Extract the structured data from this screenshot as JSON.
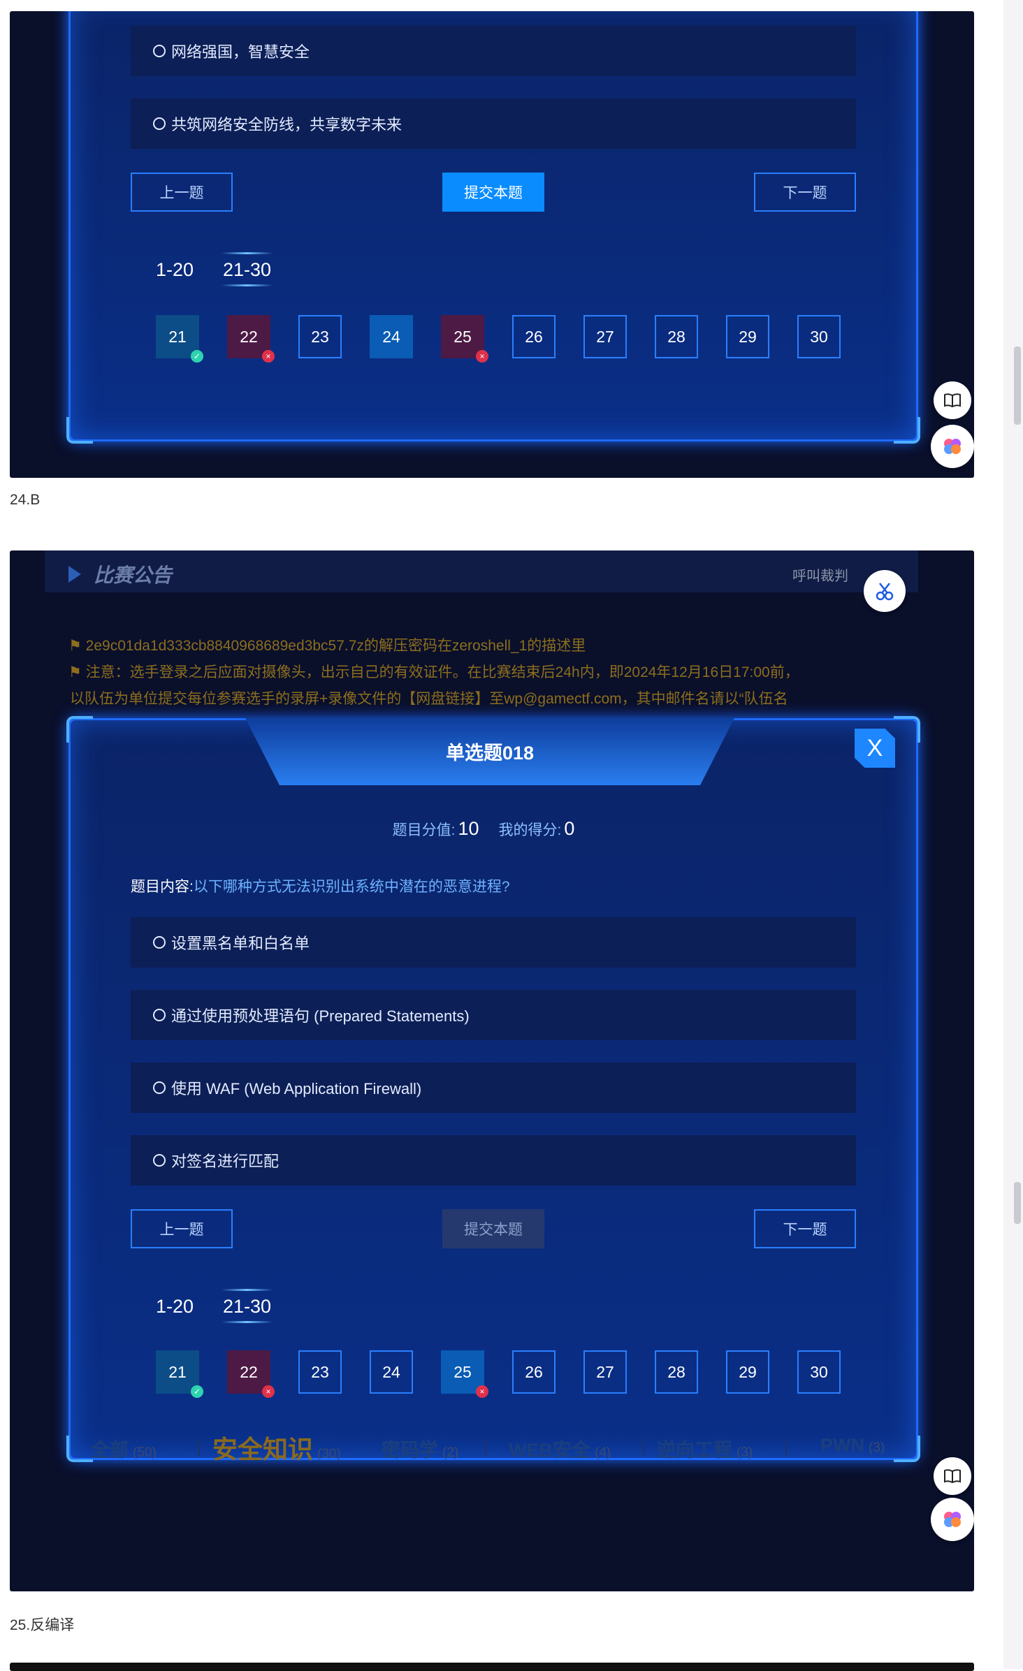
{
  "screenshot1": {
    "options": [
      "网络强国，智慧安全",
      "共筑网络安全防线，共享数字未来"
    ],
    "buttons": {
      "prev": "上一题",
      "submit": "提交本题",
      "next": "下一题"
    },
    "ranges": [
      "1-20",
      "21-30"
    ],
    "questions": [
      {
        "num": "21",
        "state": "correct"
      },
      {
        "num": "22",
        "state": "wrong"
      },
      {
        "num": "23",
        "state": "none"
      },
      {
        "num": "24",
        "state": "current"
      },
      {
        "num": "25",
        "state": "wrong"
      },
      {
        "num": "26",
        "state": "none"
      },
      {
        "num": "27",
        "state": "none"
      },
      {
        "num": "28",
        "state": "none"
      },
      {
        "num": "29",
        "state": "none"
      },
      {
        "num": "30",
        "state": "none"
      }
    ]
  },
  "caption1": "24.B",
  "screenshot2": {
    "announcement_title": "比赛公告",
    "referee": "呼叫裁判",
    "notices": [
      "2e9c01da1d333cb8840968689ed3bc57.7z的解压密码在zeroshell_1的描述里",
      "注意：选手登录之后应面对摄像头，出示自己的有效证件。在比赛结束后24h内，即2024年12月16日17:00前，",
      "以队伍为单位提交每位参赛选手的录屏+录像文件的【网盘链接】至wp@gamectf.com，其中邮件名请以“队伍名"
    ],
    "modal_title": "单选题018",
    "close": "X",
    "score_label": "题目分值:",
    "score_value": "10",
    "my_score_label": "我的得分:",
    "my_score_value": "0",
    "question_label": "题目内容:",
    "question_text": "以下哪种方式无法识别出系统中潜在的恶意进程?",
    "options": [
      "设置黑名单和白名单",
      "通过使用预处理语句 (Prepared Statements)",
      "使用 WAF (Web Application Firewall)",
      "对签名进行匹配"
    ],
    "buttons": {
      "prev": "上一题",
      "submit": "提交本题",
      "next": "下一题"
    },
    "ranges": [
      "1-20",
      "21-30"
    ],
    "questions": [
      {
        "num": "21",
        "state": "correct"
      },
      {
        "num": "22",
        "state": "wrong"
      },
      {
        "num": "23",
        "state": "none"
      },
      {
        "num": "24",
        "state": "none"
      },
      {
        "num": "25",
        "state": "current-wrong"
      },
      {
        "num": "26",
        "state": "none"
      },
      {
        "num": "27",
        "state": "none"
      },
      {
        "num": "28",
        "state": "none"
      },
      {
        "num": "29",
        "state": "none"
      },
      {
        "num": "30",
        "state": "none"
      }
    ],
    "categories": [
      {
        "name": "全部",
        "count": "(50)"
      },
      {
        "name": "安全知识",
        "count": "(30)"
      },
      {
        "name": "密码学",
        "count": "(2)"
      },
      {
        "name": "WEB安全",
        "count": "(4)"
      },
      {
        "name": "逆向工程",
        "count": "(3)"
      },
      {
        "name": "PWN",
        "count": "(3)"
      }
    ]
  },
  "caption2": "25.反编译",
  "colors": {
    "accent": "#1e86ff",
    "correct": "#2ed3b0",
    "wrong": "#e0314b",
    "gold": "#8a6a1e"
  }
}
